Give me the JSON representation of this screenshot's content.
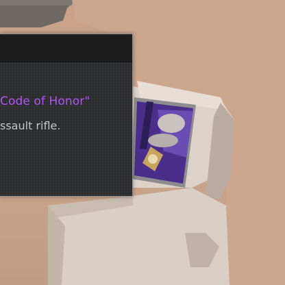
{
  "tooltip": {
    "title_visible": "Code of Honor\"",
    "description_visible": "ssault rifle."
  },
  "colors": {
    "title_accent": "#b054f2",
    "description_text": "#c4c6c6",
    "panel_background": "#2b2d2e",
    "panel_header": "#1c1c1c",
    "panel_border": "#8f9396",
    "backdrop": "#c9a186",
    "crate": "#d9cfc6",
    "banner_purple": "#4a2e8c"
  },
  "icons": {
    "banner_emblem": "lion-crest-icon"
  }
}
